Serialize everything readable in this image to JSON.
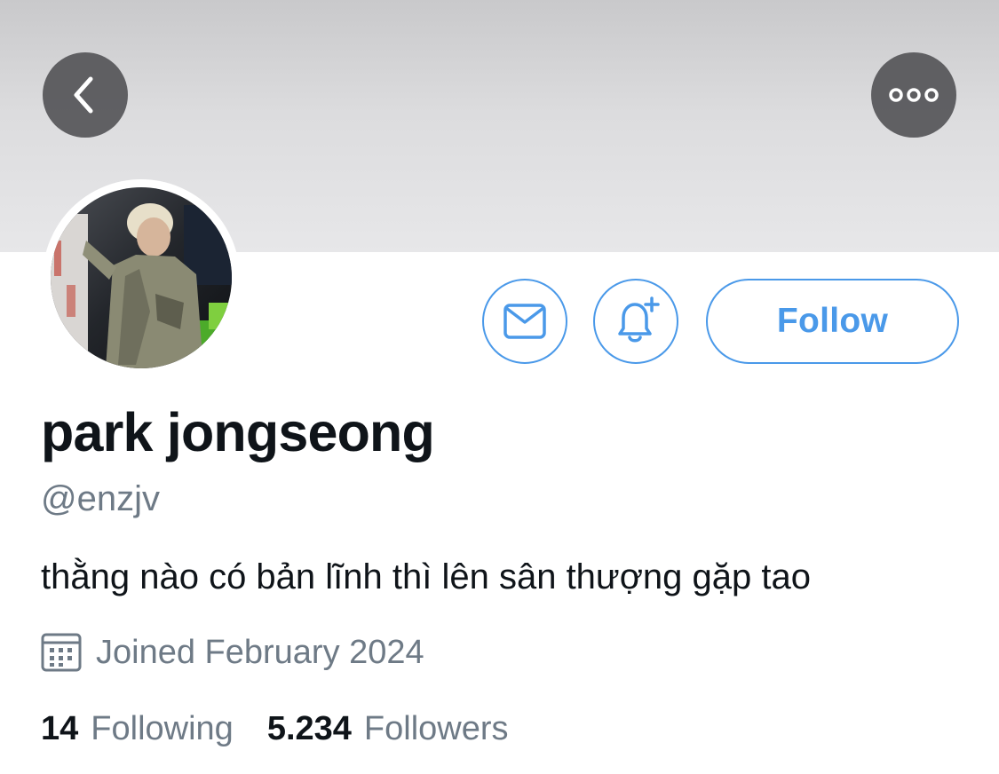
{
  "header": {
    "back_icon": "chevron-left-icon",
    "more_icon": "ellipsis-icon"
  },
  "actions": {
    "message_icon": "envelope-icon",
    "notify_icon": "bell-plus-icon",
    "follow_label": "Follow",
    "accent_color": "#4a99e9"
  },
  "profile": {
    "display_name": "park jongseong",
    "handle": "@enzjv",
    "bio": "thằng nào có bản lĩnh thì lên sân thượng gặp tao",
    "joined_icon": "calendar-icon",
    "joined": "Joined February 2024"
  },
  "stats": {
    "following_count": "14",
    "following_label": "Following",
    "followers_count": "5.234",
    "followers_label": "Followers"
  }
}
